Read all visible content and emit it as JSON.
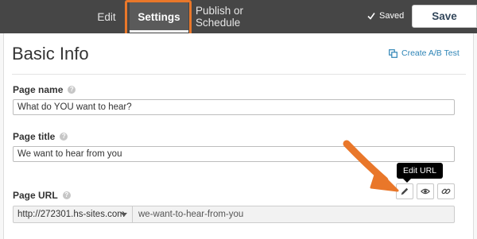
{
  "header": {
    "tabs": [
      {
        "label": "Edit"
      },
      {
        "label": "Settings"
      },
      {
        "label": "Publish or Schedule"
      }
    ],
    "saved_text": "Saved",
    "save_label": "Save"
  },
  "main": {
    "title": "Basic Info",
    "ab_test_label": "Create A/B Test",
    "page_name": {
      "label": "Page name",
      "value": "What do YOU want to hear?"
    },
    "page_title": {
      "label": "Page title",
      "value": "We want to hear from you"
    },
    "page_url": {
      "label": "Page URL",
      "domain": "http://272301.hs-sites.com",
      "slug": "we-want-to-hear-from-you"
    },
    "tooltip": "Edit URL"
  },
  "colors": {
    "header_bg": "#464646",
    "highlight": "#e9772a",
    "link": "#2d84b6"
  },
  "icons": [
    "check-icon",
    "copy-icon",
    "help-icon",
    "caret-down-icon",
    "pencil-icon",
    "eye-icon",
    "link-icon",
    "arrow-annotation"
  ]
}
